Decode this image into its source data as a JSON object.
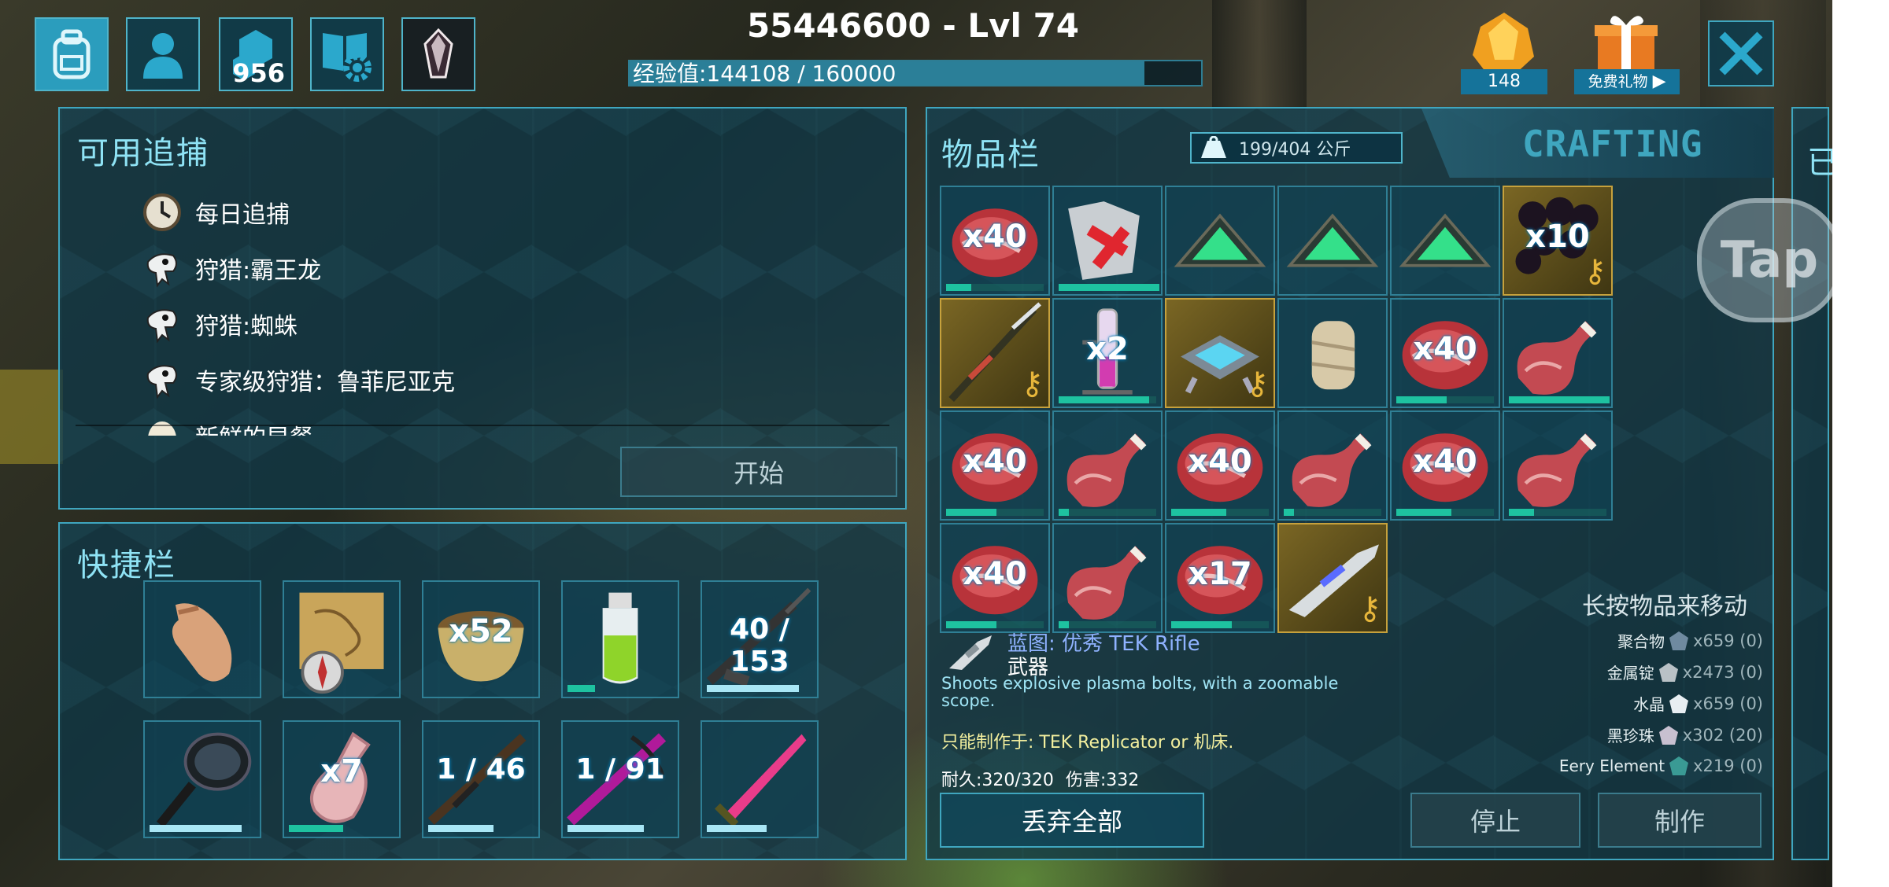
{
  "header": {
    "title": "55446600 - Lvl 74",
    "xp_text": "经验值:144108 / 160000",
    "xp_progress": 0.9007,
    "engram_count": "956",
    "element_count": "148",
    "gift_label": "免费礼物"
  },
  "bounties": {
    "title": "可用追捕",
    "items": [
      {
        "label": "每日追捕",
        "icon": "clock-icon"
      },
      {
        "label": "狩猎:霸王龙",
        "icon": "dino-skull-icon"
      },
      {
        "label": "狩猎:蜘蛛",
        "icon": "dino-skull-icon"
      },
      {
        "label": "专家级狩猎：鲁菲尼亚克",
        "icon": "dino-skull-icon"
      },
      {
        "label": "新鲜的早餐",
        "icon": "egg-icon"
      }
    ],
    "start_label": "开始"
  },
  "hotbar": {
    "title": "快捷栏",
    "slots": [
      {
        "name": "hand",
        "qty": "",
        "bar": null
      },
      {
        "name": "map",
        "qty": "",
        "bar": null
      },
      {
        "name": "bowl",
        "qty": "x52",
        "bar": null
      },
      {
        "name": "stimulant-bottle",
        "qty": "",
        "bar": 0.25
      },
      {
        "name": "rifle",
        "qty": "40 / 153",
        "bar": 0.85
      },
      {
        "name": "frying-pan",
        "qty": "",
        "bar": 0.85
      },
      {
        "name": "bottle",
        "qty": "x7",
        "bar": 0.5
      },
      {
        "name": "musket",
        "qty": "1 / 46",
        "bar": 0.6
      },
      {
        "name": "crossbow",
        "qty": "1 / 91",
        "bar": 0.7
      },
      {
        "name": "sword",
        "qty": "",
        "bar": 0.55
      }
    ]
  },
  "inventory": {
    "title": "物品栏",
    "weight": "199/404 公斤",
    "crafting_tab": "CRAFTING",
    "hint": "长按物品来移动",
    "slots": [
      {
        "name": "raw-meat",
        "qty": "x40",
        "bar": 0.25,
        "gold": false
      },
      {
        "name": "chitin-armor",
        "qty": "",
        "bar": 1.0,
        "gold": false
      },
      {
        "name": "tek-pyramid",
        "qty": "",
        "bar": null,
        "gold": false
      },
      {
        "name": "tek-pyramid",
        "qty": "",
        "bar": null,
        "gold": false
      },
      {
        "name": "tek-pyramid",
        "qty": "",
        "bar": null,
        "gold": false
      },
      {
        "name": "black-pearl",
        "qty": "x10",
        "bar": null,
        "gold": true
      },
      {
        "name": "rifle-blueprint",
        "qty": "",
        "bar": null,
        "gold": true
      },
      {
        "name": "tube",
        "qty": "x2",
        "bar": 0.9,
        "gold": false
      },
      {
        "name": "tek-platform",
        "qty": "",
        "bar": null,
        "gold": true
      },
      {
        "name": "bandage",
        "qty": "",
        "bar": null,
        "gold": false
      },
      {
        "name": "raw-meat",
        "qty": "x40",
        "bar": 0.5,
        "gold": false
      },
      {
        "name": "ham",
        "qty": "",
        "bar": 1.0,
        "gold": false
      },
      {
        "name": "raw-meat",
        "qty": "x40",
        "bar": 0.5,
        "gold": false
      },
      {
        "name": "ham",
        "qty": "",
        "bar": 0.1,
        "gold": false
      },
      {
        "name": "raw-meat",
        "qty": "x40",
        "bar": 0.55,
        "gold": false
      },
      {
        "name": "ham",
        "qty": "",
        "bar": 0.1,
        "gold": false
      },
      {
        "name": "raw-meat",
        "qty": "x40",
        "bar": 0.55,
        "gold": false
      },
      {
        "name": "ham",
        "qty": "",
        "bar": 0.25,
        "gold": false
      },
      {
        "name": "raw-meat",
        "qty": "x40",
        "bar": 0.5,
        "gold": false
      },
      {
        "name": "ham",
        "qty": "",
        "bar": 0.1,
        "gold": false
      },
      {
        "name": "raw-meat",
        "qty": "x17",
        "bar": 0.6,
        "gold": false
      },
      {
        "name": "tek-rifle-blueprint",
        "qty": "",
        "bar": null,
        "gold": true
      }
    ]
  },
  "details": {
    "name": "蓝图: 优秀 TEK Rifle",
    "type": "武器",
    "description": "Shoots explosive plasma bolts, with a zoomable scope.",
    "craft_at": "只能制作于: TEK Replicator or 机床.",
    "durability_label": "耐久:",
    "durability": "320/320",
    "damage_label": "伤害:",
    "damage": "332"
  },
  "resources": [
    {
      "label": "聚合物",
      "amount": "x659 (0)",
      "icon": "polymer-icon"
    },
    {
      "label": "金属锭",
      "amount": "x2473 (0)",
      "icon": "ingot-icon"
    },
    {
      "label": "水晶",
      "amount": "x659 (0)",
      "icon": "crystal-icon"
    },
    {
      "label": "黑珍珠",
      "amount": "x302 (20)",
      "icon": "pearl-icon"
    },
    {
      "label": "Eery Element",
      "amount": "x219 (0)",
      "icon": "element-icon"
    }
  ],
  "buttons": {
    "drop_all": "丢弃全部",
    "stop": "停止",
    "craft": "制作",
    "tap": "Tap"
  },
  "colors": {
    "accent": "#3fa6bf",
    "title": "#8fe3f5",
    "gold": "#c6a13c",
    "progress": "#1ec2a0"
  }
}
